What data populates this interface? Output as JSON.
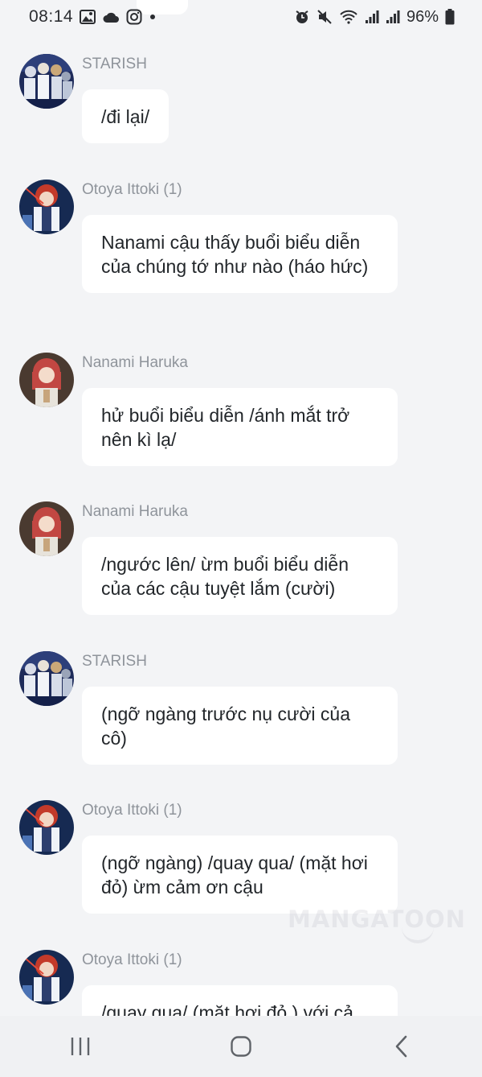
{
  "status_bar": {
    "time": "08:14",
    "battery_percent": "96%",
    "left_icons": [
      "gallery-icon",
      "cloud-icon",
      "instagram-icon",
      "dot-icon"
    ],
    "right_icons": [
      "alarm-icon",
      "mute-icon",
      "wifi-icon",
      "signal-icon",
      "signal-icon",
      "battery-icon"
    ]
  },
  "messages": [
    {
      "sender": "STARISH",
      "text": "/đi lại/",
      "avatar": "group"
    },
    {
      "sender": "Otoya Ittoki (1)",
      "text": "Nanami cậu thấy buổi biểu diễn của chúng tớ như nào (háo hức)",
      "avatar": "otoya"
    },
    {
      "sender": "Nanami Haruka",
      "text": "hử buổi biểu diễn /ánh mắt trở nên kì lạ/",
      "avatar": "nanami"
    },
    {
      "sender": "Nanami Haruka",
      "text": "/ngước lên/ ừm buổi biểu diễn của các cậu tuyệt lắm (cười)",
      "avatar": "nanami"
    },
    {
      "sender": "STARISH",
      "text": "(ngỡ ngàng trước nụ cười của cô)",
      "avatar": "group"
    },
    {
      "sender": "Otoya Ittoki (1)",
      "text": "(ngỡ ngàng) /quay qua/ (mặt hơi đỏ) ừm cảm ơn cậu",
      "avatar": "otoya"
    },
    {
      "sender": "Otoya Ittoki (1)",
      "text": "/quay qua/ (mặt hơi đỏ ) với cả",
      "avatar": "otoya"
    }
  ],
  "watermark": "MANGATOON",
  "nav_bar": {
    "buttons": [
      "recent-apps",
      "home",
      "back"
    ]
  },
  "colors": {
    "background": "#f3f4f6",
    "bubble": "#ffffff",
    "sender_text": "#8f949b",
    "message_text": "#22262a"
  }
}
